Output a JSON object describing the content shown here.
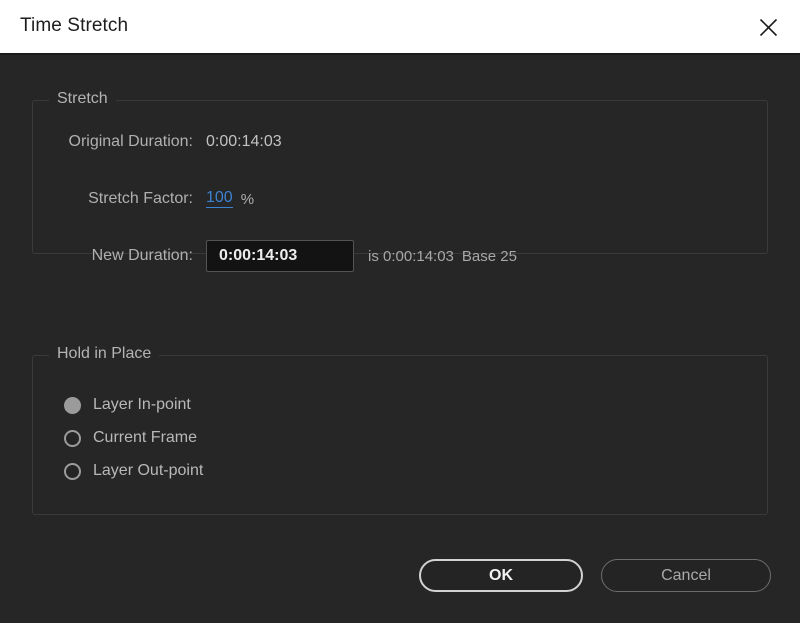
{
  "window": {
    "title": "Time Stretch",
    "close_icon": "close-icon"
  },
  "stretch_group": {
    "legend": "Stretch",
    "rows": [
      {
        "label": "Original Duration:",
        "value": "0:00:14:03"
      },
      {
        "label": "Stretch Factor:",
        "value": "100",
        "unit": "%"
      },
      {
        "label": "New Duration:",
        "value": "0:00:14:03",
        "note_is": "is 0:00:14:03",
        "note_base": "Base 25"
      }
    ]
  },
  "hold_group": {
    "legend": "Hold in Place",
    "options": [
      {
        "label": "Layer In-point",
        "selected": true
      },
      {
        "label": "Current Frame",
        "selected": false
      },
      {
        "label": "Layer Out-point",
        "selected": false
      }
    ]
  },
  "footer": {
    "ok_label": "OK",
    "cancel_label": "Cancel"
  },
  "colors": {
    "titlebar_bg": "#ffffff",
    "dialog_bg": "#262626",
    "accent_blue": "#3c82d2",
    "label_gray": "#b0b0b0",
    "group_border": "#3a3a3a"
  }
}
